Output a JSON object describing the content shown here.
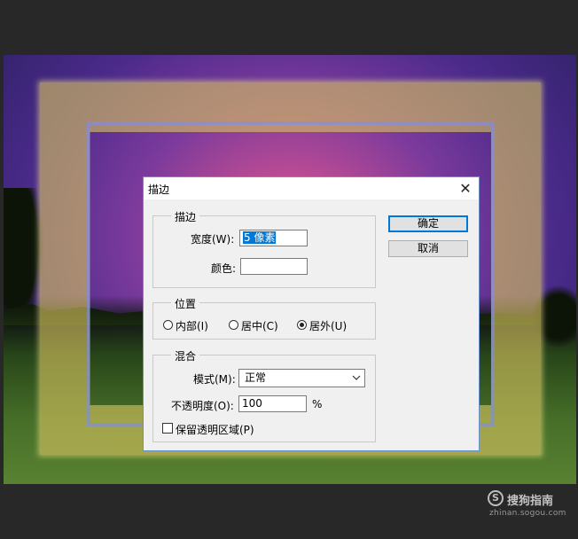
{
  "dialog": {
    "title": "描边",
    "close_glyph": "✕",
    "stroke_group": {
      "label": "描边",
      "width_label": "宽度(W):",
      "width_value": "5 像素",
      "color_label": "颜色:"
    },
    "position_group": {
      "label": "位置",
      "options": [
        "内部(I)",
        "居中(C)",
        "居外(U)"
      ],
      "selected": "居外(U)"
    },
    "blend_group": {
      "label": "混合",
      "mode_label": "模式(M):",
      "mode_value": "正常",
      "opacity_label": "不透明度(O):",
      "opacity_value": "100",
      "opacity_unit": "%",
      "preserve_label": "保留透明区域(P)",
      "preserve_checked": false
    },
    "ok_label": "确定",
    "cancel_label": "取消"
  },
  "watermark": {
    "brand": "搜狗指南",
    "url": "zhinan.sogou.com",
    "logo_letter": "S"
  },
  "colors": {
    "accent": "#0078d7",
    "app_background": "#282828",
    "stroke_frame": "#d6c460"
  }
}
